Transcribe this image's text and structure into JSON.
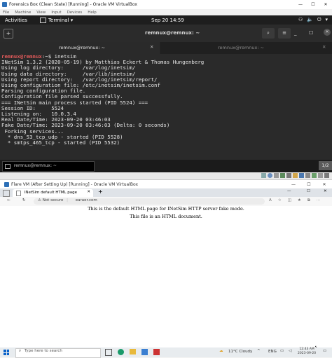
{
  "host_window": {
    "title": "Forensics Box (Clean State) [Running] - Oracle VM VirtualBox",
    "menu": [
      "File",
      "Machine",
      "View",
      "Input",
      "Devices",
      "Help"
    ]
  },
  "gnome": {
    "activities": "Activities",
    "app": "Terminal ▾",
    "clock": "Sep 20  14:59"
  },
  "terminal": {
    "header_title": "remnux@remnux: ~",
    "tabs": [
      {
        "label": "remnux@remnux: ~",
        "active": true
      },
      {
        "label": "remnux@remnux: ~",
        "active": false
      }
    ],
    "prompt_user": "remnux@remnux",
    "prompt_path": ":~$ inetsim",
    "lines": [
      "INetSim 1.3.2 (2020-05-19) by Matthias Eckert & Thomas Hungenberg",
      "Using log directory:      /var/log/inetsim/",
      "Using data directory:     /var/lib/inetsim/",
      "Using report directory:   /var/log/inetsim/report/",
      "Using configuration file: /etc/inetsim/inetsim.conf",
      "Parsing configuration file.",
      "Configuration file parsed successfully.",
      "=== INetSim main process started (PID 5524) ===",
      "Session ID:     5524",
      "Listening on:   10.0.3.4",
      "Real Date/Time: 2023-09-20 03:46:03",
      "Fake Date/Time: 2023-09-20 03:46:03 (Delta: 0 seconds)",
      " Forking services...",
      "  * dns_53_tcp_udp - started (PID 5528)",
      "  * smtps_465_tcp - started (PID 5532)"
    ],
    "taskbar_item": "remnux@remnux: ~",
    "page_indicator": "1/2"
  },
  "guest_window": {
    "title": "Flare VM (After Setting Up) [Running] - Oracle VM VirtualBox",
    "tab_label": "INetSim default HTML page",
    "not_secure": "Not secure",
    "url": "earaer.com",
    "page_line1": "This is the default HTML page for INetSim HTTP server fake mode.",
    "page_line2": "This file is an HTML document."
  },
  "win_taskbar": {
    "search_placeholder": "Type here to search",
    "weather": "11°C  Cloudy",
    "lang": "ENG",
    "time": "12:43 AM",
    "date": "2023-09-20"
  },
  "colors": {
    "terminal_bg": "#2a2a2a",
    "prompt_user": "#e25a5a",
    "gnome_bar": "#1e1e1e"
  }
}
